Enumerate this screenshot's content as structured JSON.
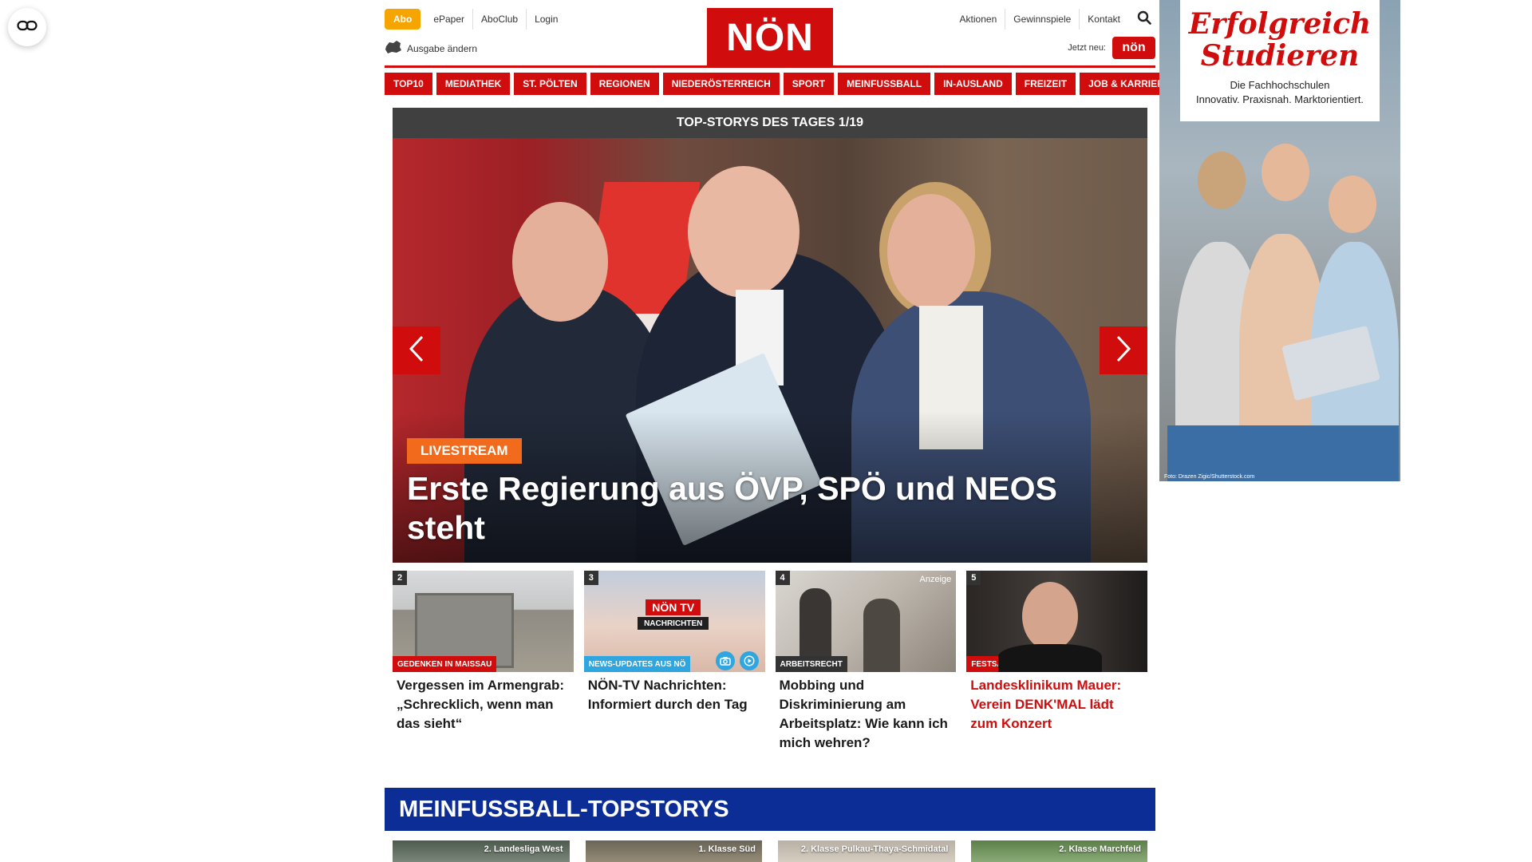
{
  "corner_button": {
    "icon": "link-icon"
  },
  "header": {
    "abo_label": "Abo",
    "util_left": [
      "ePaper",
      "AboClub",
      "Login"
    ],
    "ausgabe_label": "Ausgabe ändern",
    "logo_text": "NÖN",
    "util_right": [
      "Aktionen",
      "Gewinnspiele",
      "Kontakt"
    ],
    "jetzt_label": "Jetzt neu:",
    "app_badge_text": "nön"
  },
  "nav": [
    "TOP10",
    "MEDIATHEK",
    "ST. PÖLTEN",
    "REGIONEN",
    "NIEDERÖSTERREICH",
    "SPORT",
    "MEINFUSSBALL",
    "IN-AUSLAND",
    "FREIZEIT",
    "JOB & KARRIERE"
  ],
  "slider": {
    "heading": "TOP-STORYS DES TAGES 1/19",
    "tag": "LIVESTREAM",
    "title": "Erste Regierung aus ÖVP, SPÖ und NEOS steht"
  },
  "cards": [
    {
      "num": "2",
      "tag": "GEDENKEN IN MAISSAU",
      "tag_color": "#d00c0c",
      "title": "Vergessen im Armengrab: „Schrecklich, wenn man das sieht“",
      "red": false
    },
    {
      "num": "3",
      "tag": "NEWS-UPDATES AUS NÖ",
      "tag_color": "#2fa6e0",
      "title": "NÖN-TV Nachrichten: Informiert durch den Tag",
      "red": false,
      "tv_top": "NÖN TV",
      "tv_bottom": "NACHRICHTEN"
    },
    {
      "num": "4",
      "tag": "ARBEITSRECHT",
      "tag_color": "#333333",
      "title": "Mobbing und Diskriminierung am Arbeitsplatz: Wie kann ich mich wehren?",
      "red": false,
      "anzeige": "Anzeige"
    },
    {
      "num": "5",
      "tag": "FESTSAAL LANDESKLINIKUM",
      "tag_color": "#d00c0c",
      "title": "Landesklinikum Mauer: Verein DENK'MAL lädt zum Konzert",
      "red": true
    }
  ],
  "meinfussball": {
    "heading": "MEINFUSSBALL-TOPSTORYS",
    "cards": [
      "2. Landesliga West",
      "1. Klasse Süd",
      "2. Klasse Pulkau-Thaya-Schmidatal",
      "2. Klasse Marchfeld"
    ]
  },
  "ad": {
    "title": "Erfolgreich Studieren",
    "sub_line1": "Die Fachhochschulen",
    "sub_line2": "Innovativ. Praxisnah. Marktorientiert.",
    "credit": "Foto: Drazen Zigic/Shutterstock.com"
  }
}
